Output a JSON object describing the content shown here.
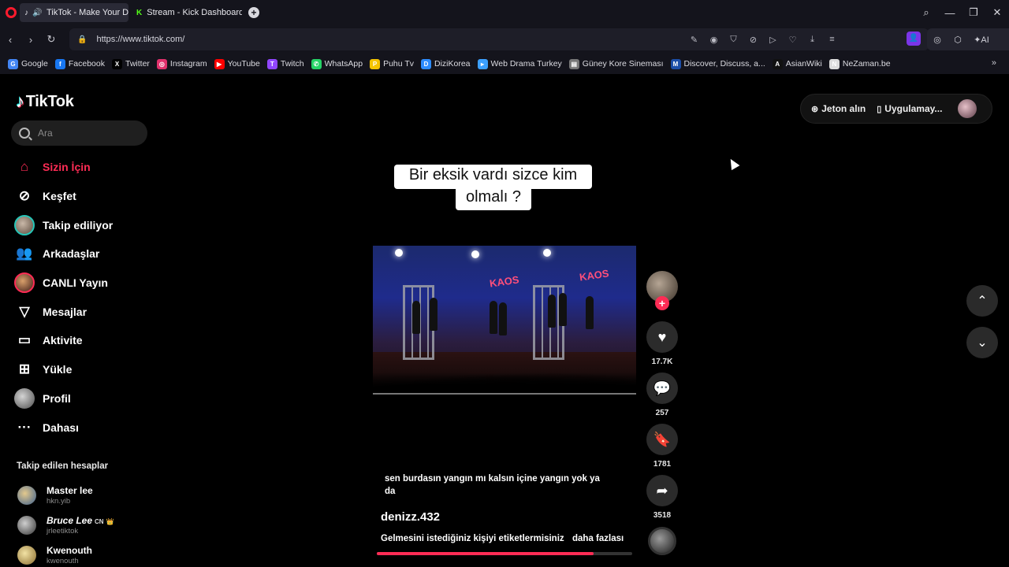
{
  "browser": {
    "tabs": [
      {
        "label": "TikTok - Make Your Da"
      },
      {
        "label": "Stream - Kick Dashboard"
      }
    ],
    "url": "https://www.tiktok.com/",
    "ai_label": "AI",
    "bookmarks": [
      {
        "label": "Google",
        "icon": "google-icon",
        "color": "#4285f4"
      },
      {
        "label": "Facebook",
        "icon": "facebook-icon",
        "color": "#1877f2"
      },
      {
        "label": "Twitter",
        "icon": "x-icon",
        "color": "#000000"
      },
      {
        "label": "Instagram",
        "icon": "instagram-icon",
        "color": "#e1306c"
      },
      {
        "label": "YouTube",
        "icon": "youtube-icon",
        "color": "#ff0000"
      },
      {
        "label": "Twitch",
        "icon": "twitch-icon",
        "color": "#9146ff"
      },
      {
        "label": "WhatsApp",
        "icon": "whatsapp-icon",
        "color": "#25d366"
      },
      {
        "label": "Puhu Tv",
        "icon": "puhutv-icon",
        "color": "#f5c400"
      },
      {
        "label": "DiziKorea",
        "icon": "dizikorea-icon",
        "color": "#2d8cff"
      },
      {
        "label": "Web Drama Turkey",
        "icon": "webdrama-icon",
        "color": "#3ca0ff"
      },
      {
        "label": "Güney Kore Sineması",
        "icon": "film-icon",
        "color": "#777777"
      },
      {
        "label": "Discover, Discuss, a...",
        "icon": "mdl-icon",
        "color": "#1c4ea8"
      },
      {
        "label": "AsianWiki",
        "icon": "asianwiki-icon",
        "color": "#111111"
      },
      {
        "label": "NeZaman.be",
        "icon": "nezaman-icon",
        "color": "#dddddd"
      }
    ]
  },
  "tiktok": {
    "logo": "TikTok",
    "search_placeholder": "Ara",
    "nav": [
      {
        "label": "Sizin İçin",
        "icon": "home-icon"
      },
      {
        "label": "Keşfet",
        "icon": "compass-icon"
      },
      {
        "label": "Takip ediliyor",
        "icon": "avatar-icon"
      },
      {
        "label": "Arkadaşlar",
        "icon": "friends-icon"
      },
      {
        "label": "CANLI Yayın",
        "icon": "live-icon"
      },
      {
        "label": "Mesajlar",
        "icon": "send-icon"
      },
      {
        "label": "Aktivite",
        "icon": "activity-icon"
      },
      {
        "label": "Yükle",
        "icon": "upload-icon"
      },
      {
        "label": "Profil",
        "icon": "profile-icon"
      },
      {
        "label": "Dahası",
        "icon": "more-icon"
      }
    ],
    "following_title": "Takip edilen hesaplar",
    "accounts": [
      {
        "name": "Master lee",
        "handle": "hkn.yib",
        "badge": ""
      },
      {
        "name": "Bruce Lee",
        "handle": "jrleetiktok",
        "badge": "CN"
      },
      {
        "name": "Kwenouth",
        "handle": "kwenouth",
        "badge": ""
      }
    ],
    "top_actions": {
      "coins": "Jeton alın",
      "app": "Uygulamay..."
    },
    "video": {
      "caption_line1": "Bir eksik vardı sizce kim",
      "caption_line2": "olmalı ?",
      "description": "sen burdasın yangın mı kalsın içine yangın yok ya da",
      "author": "denizz.432",
      "music": "Gelmesini istediğiniz kişiyi etiketlermisiniz",
      "more": "daha fazlası",
      "progress": 0.85,
      "likes": "17.7K",
      "comments": "257",
      "saves": "1781",
      "shares": "3518"
    }
  }
}
